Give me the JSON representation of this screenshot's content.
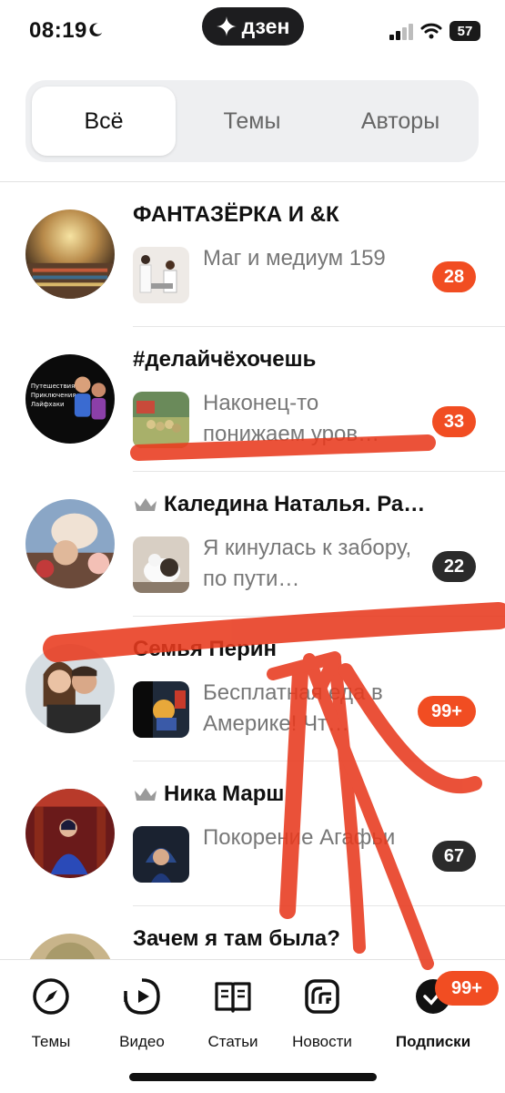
{
  "status_bar": {
    "time": "08:19",
    "brand": "дзен",
    "battery": "57"
  },
  "tabs": [
    {
      "label": "Всё",
      "active": true
    },
    {
      "label": "Темы",
      "active": false
    },
    {
      "label": "Авторы",
      "active": false
    }
  ],
  "subscriptions": [
    {
      "channel": "ФАНТАЗЁРКА И &К",
      "premium": false,
      "post_title": "Маг и медиум 159",
      "count": "28",
      "badge_color": "#f14d22"
    },
    {
      "channel": "#делайчёхочешь",
      "premium": false,
      "post_title": "Наконец-то понижаем уров…",
      "count": "33",
      "badge_color": "#f14d22"
    },
    {
      "channel": "Каледина Наталья. Ра…",
      "premium": true,
      "post_title": "Я кинулась к забору, по пути…",
      "count": "22",
      "badge_color": "#2b2b2b"
    },
    {
      "channel": "Семья Перин",
      "premium": false,
      "post_title": "Бесплатная еда в Америке! Чт…",
      "count": "99+",
      "badge_color": "#f14d22"
    },
    {
      "channel": "Ника Марш",
      "premium": true,
      "post_title": "Покорение Агафьи",
      "count": "67",
      "badge_color": "#2b2b2b"
    },
    {
      "channel": "Зачем я там была?",
      "premium": false,
      "post_title": "",
      "count": "",
      "badge_color": "#2b2b2b"
    }
  ],
  "bottom_nav": [
    {
      "label": "Темы",
      "icon": "compass-icon",
      "active": false
    },
    {
      "label": "Видео",
      "icon": "play-icon",
      "active": false
    },
    {
      "label": "Статьи",
      "icon": "book-icon",
      "active": false
    },
    {
      "label": "Новости",
      "icon": "news-icon",
      "active": false
    },
    {
      "label": "Подписки",
      "icon": "subscriptions-icon",
      "active": true
    }
  ],
  "subscriptions_badge": "99+",
  "colors": {
    "accent": "#f14d22",
    "annotation": "#e83a1e",
    "dark_badge": "#2b2b2b"
  }
}
